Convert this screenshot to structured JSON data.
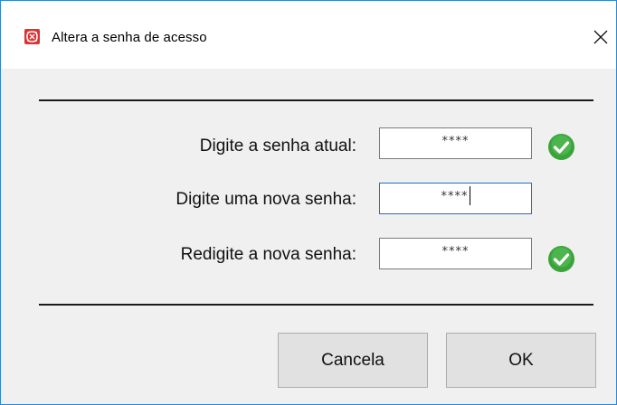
{
  "window": {
    "title": "Altera a senha de acesso"
  },
  "form": {
    "current_label": "Digite a senha atual:",
    "current_value": "****",
    "new_label": "Digite uma nova senha:",
    "new_value": "****",
    "confirm_label": "Redigite a nova senha:",
    "confirm_value": "****"
  },
  "buttons": {
    "cancel": "Cancela",
    "ok": "OK"
  },
  "colors": {
    "accent": "#2b87d8",
    "check_green": "#3aa43a",
    "app_icon_red": "#e03030"
  },
  "icons": {
    "app": "app-logo-icon",
    "close": "close-icon",
    "valid": "check-circle-icon"
  }
}
